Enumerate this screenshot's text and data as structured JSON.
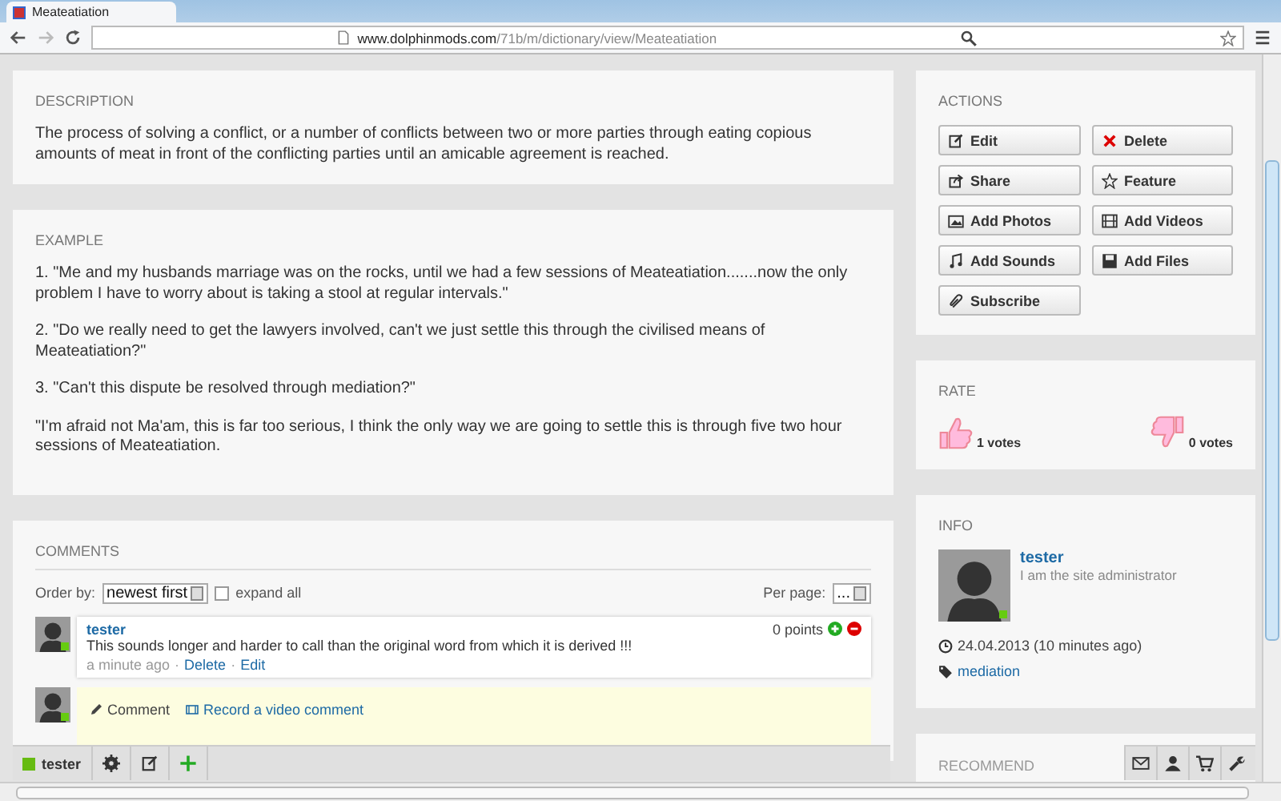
{
  "browser": {
    "tab_title": "Meateatiation",
    "url_host": "www.dolphinmods.com",
    "url_path": "/71b/m/dictionary/view/Meateatiation"
  },
  "description": {
    "heading": "DESCRIPTION",
    "text": "The process of solving a conflict, or a number of conflicts between two or more parties through eating copious amounts of meat in front of the conflicting parties until an amicable agreement is reached."
  },
  "example": {
    "heading": "EXAMPLE",
    "paragraphs": [
      "1. \"Me and my husbands marriage was on the rocks, until we had a few sessions of Meateatiation.......now the only problem I have to worry about is taking a stool at regular intervals.\"",
      "2. \"Do we really need to get the lawyers involved, can't we just settle this through the civilised means of Meateatiation?\"",
      "3. \"Can't this dispute be resolved through mediation?\"",
      "\"I'm afraid not Ma'am, this is far too serious, I think the only way we are going to settle this is through five two hour sessions of Meateatiation."
    ]
  },
  "comments": {
    "heading": "COMMENTS",
    "order_label": "Order by:",
    "order_value": "newest first",
    "expand_all": {
      "label": "expand all",
      "checked": false
    },
    "per_page_label": "Per page:",
    "per_page_value": "...",
    "items": [
      {
        "author": "tester",
        "online": true,
        "points": "0 points",
        "text": "This sounds longer and harder to call than the original word from which it is derived !!!",
        "time": "a minute ago",
        "separator": "·",
        "links": [
          "Delete",
          "Edit"
        ]
      }
    ],
    "composer": {
      "online": true,
      "actions": [
        {
          "kind": "comment",
          "label": "Comment"
        },
        {
          "kind": "video",
          "label": "Record a video comment"
        }
      ]
    }
  },
  "actions": {
    "heading": "ACTIONS",
    "buttons": [
      {
        "kind": "edit",
        "label": "Edit"
      },
      {
        "kind": "delete",
        "label": "Delete"
      },
      {
        "kind": "share",
        "label": "Share"
      },
      {
        "kind": "feature",
        "label": "Feature"
      },
      {
        "kind": "photos",
        "label": "Add Photos"
      },
      {
        "kind": "videos",
        "label": "Add Videos"
      },
      {
        "kind": "sounds",
        "label": "Add Sounds"
      },
      {
        "kind": "files",
        "label": "Add Files"
      },
      {
        "kind": "subscribe",
        "label": "Subscribe"
      }
    ]
  },
  "rate": {
    "heading": "RATE",
    "up": "1 votes",
    "down": "0 votes"
  },
  "info": {
    "heading": "INFO",
    "name": "tester",
    "online": true,
    "status": "I am the site administrator",
    "date": "24.04.2013 (10 minutes ago)",
    "tag": "mediation"
  },
  "recommend": {
    "heading": "RECOMMEND"
  },
  "toolbar": {
    "user": "tester",
    "online": true
  }
}
